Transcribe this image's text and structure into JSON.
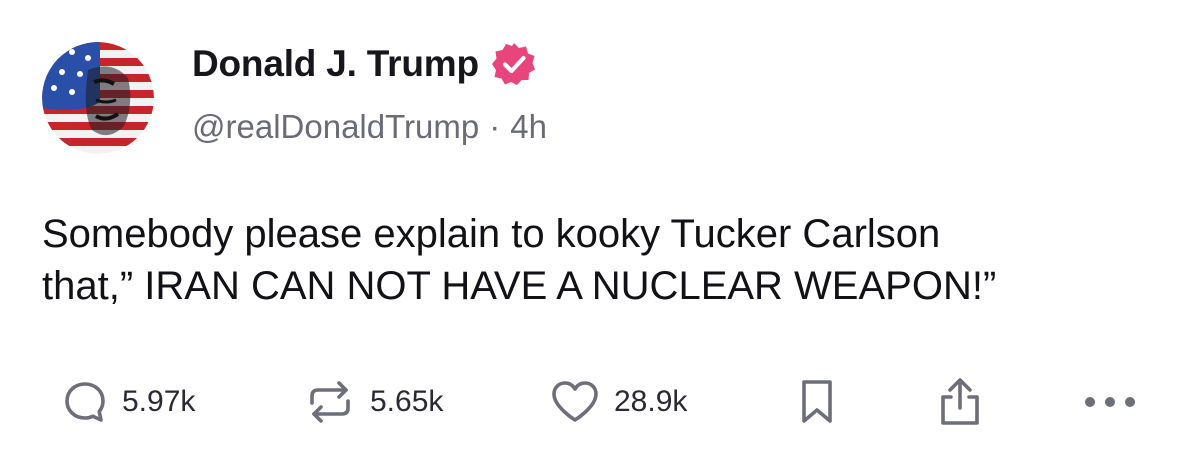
{
  "author": {
    "display_name": "Donald J. Trump",
    "handle": "@realDonaldTrump",
    "separator": "·",
    "timestamp": "4h",
    "verified": true,
    "avatar_icon": "avatar-flag-face",
    "verified_icon": "verified-badge-icon"
  },
  "post": {
    "lines": [
      "Somebody please explain to kooky Tucker Carlson",
      "that,” IRAN CAN NOT HAVE A NUCLEAR WEAPON!”"
    ]
  },
  "actions": {
    "reply": {
      "icon": "reply-icon",
      "count": "5.97k"
    },
    "repost": {
      "icon": "repost-icon",
      "count": "5.65k"
    },
    "like": {
      "icon": "heart-icon",
      "count": "28.9k"
    },
    "bookmark": {
      "icon": "bookmark-icon"
    },
    "share": {
      "icon": "share-icon"
    },
    "more": {
      "icon": "more-icon"
    }
  },
  "colors": {
    "verified_badge": "#e8457d",
    "text_primary": "#16161c",
    "text_secondary": "#6b6b78",
    "icon_gray": "#6e6e7a"
  }
}
